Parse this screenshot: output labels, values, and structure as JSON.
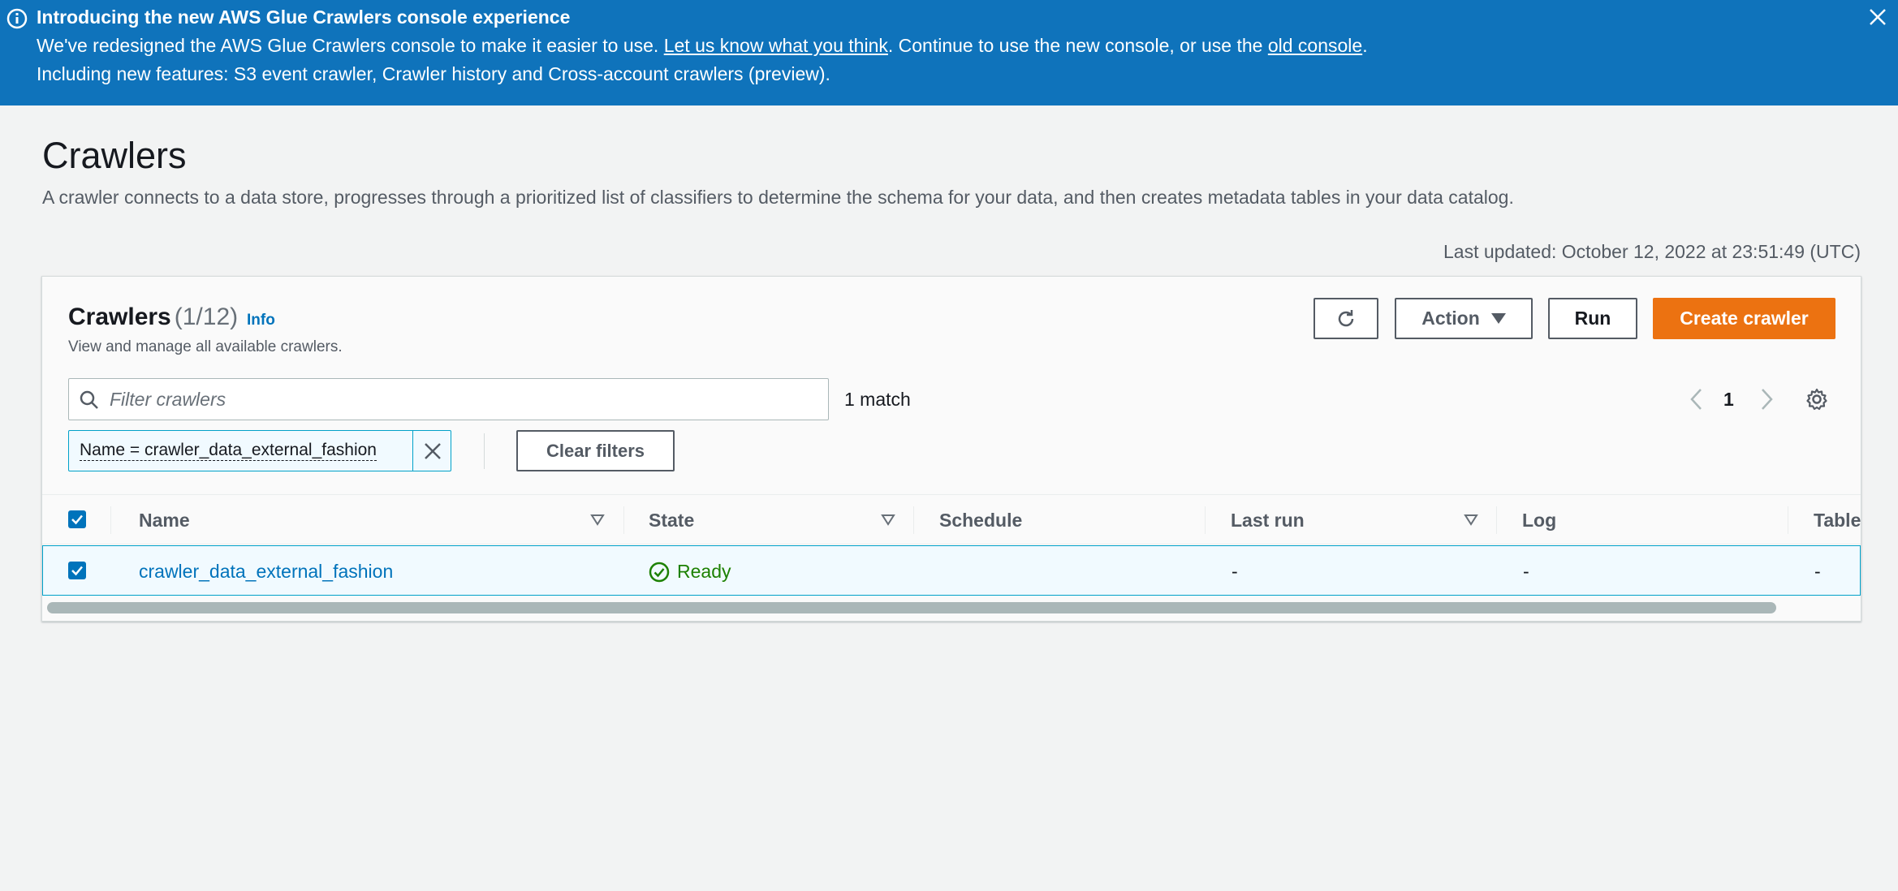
{
  "banner": {
    "title": "Introducing the new AWS Glue Crawlers console experience",
    "line1_prefix": "We've redesigned the AWS Glue Crawlers console to make it easier to use. ",
    "feedback_link": "Let us know what you think",
    "line1_middle": ". Continue to use the new console, or use the ",
    "old_console_link": "old console",
    "line1_suffix": ".",
    "line2": "Including new features: S3 event crawler, Crawler history and Cross-account crawlers (preview)."
  },
  "page": {
    "title": "Crawlers",
    "description": "A crawler connects to a data store, progresses through a prioritized list of classifiers to determine the schema for your data, and then creates metadata tables in your data catalog.",
    "last_updated": "Last updated: October 12, 2022 at 23:51:49 (UTC)"
  },
  "container": {
    "title": "Crawlers",
    "count": "(1/12)",
    "info": "Info",
    "subtitle": "View and manage all available crawlers.",
    "action_label": "Action",
    "run_label": "Run",
    "create_label": "Create crawler",
    "filter_placeholder": "Filter crawlers",
    "match_text": "1 match",
    "page_number": "1",
    "token_label": "Name = crawler_data_external_fashion",
    "clear_filters": "Clear filters"
  },
  "table": {
    "columns": [
      "Name",
      "State",
      "Schedule",
      "Last run",
      "Log",
      "Table"
    ],
    "rows": [
      {
        "name": "crawler_data_external_fashion",
        "state": "Ready",
        "schedule": "",
        "last_run": "-",
        "log": "-",
        "table": "-"
      }
    ]
  },
  "colors": {
    "banner": "#0f73bb",
    "primary_button": "#ec7211",
    "link": "#0073bb",
    "success": "#1d8102"
  }
}
